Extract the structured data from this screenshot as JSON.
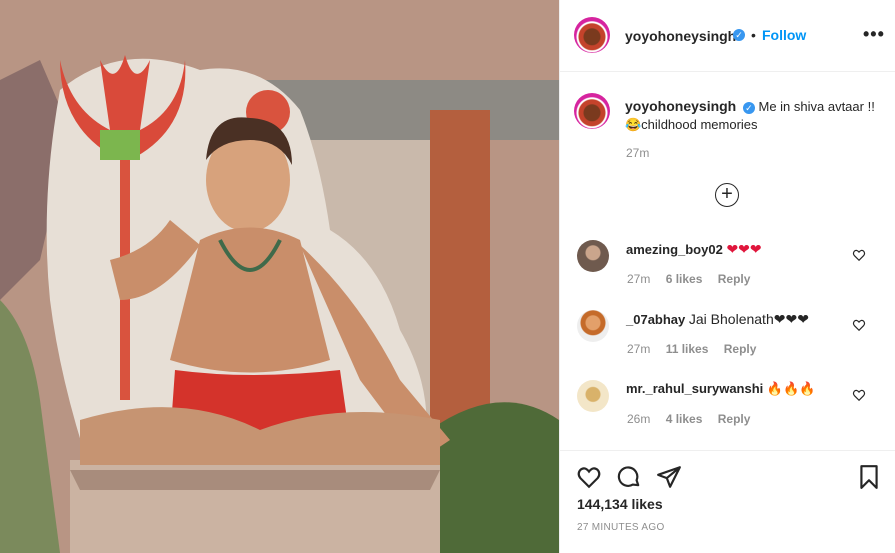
{
  "post": {
    "username": "yoyohoneysingh",
    "verified_mark": "✓",
    "separator": "•",
    "follow_label": "Follow",
    "more_label": "•••",
    "caption_text": "Me in shiva avtaar !! 😂childhood memories",
    "caption_time": "27m",
    "load_more_label": "+",
    "likes": "144,134 likes",
    "posted": "27 MINUTES AGO"
  },
  "comments": [
    {
      "user": "amezing_boy02",
      "text": "❤❤❤",
      "time": "27m",
      "likes": "6 likes",
      "reply": "Reply"
    },
    {
      "user": "_07abhay",
      "text": "Jai Bholenath❤❤❤",
      "time": "27m",
      "likes": "11 likes",
      "reply": "Reply"
    },
    {
      "user": "mr._rahul_surywanshi",
      "text": "🔥🔥🔥",
      "time": "26m",
      "likes": "4 likes",
      "reply": "Reply"
    }
  ],
  "icons": {
    "like": "heart-icon",
    "comment": "comment-icon",
    "share": "share-icon",
    "save": "bookmark-icon",
    "more": "more-options-icon",
    "load_more": "add-circle-icon"
  },
  "colors": {
    "follow": "#0095f6",
    "verified": "#3897f0",
    "meta": "#8e8e8e",
    "text": "#262626"
  }
}
